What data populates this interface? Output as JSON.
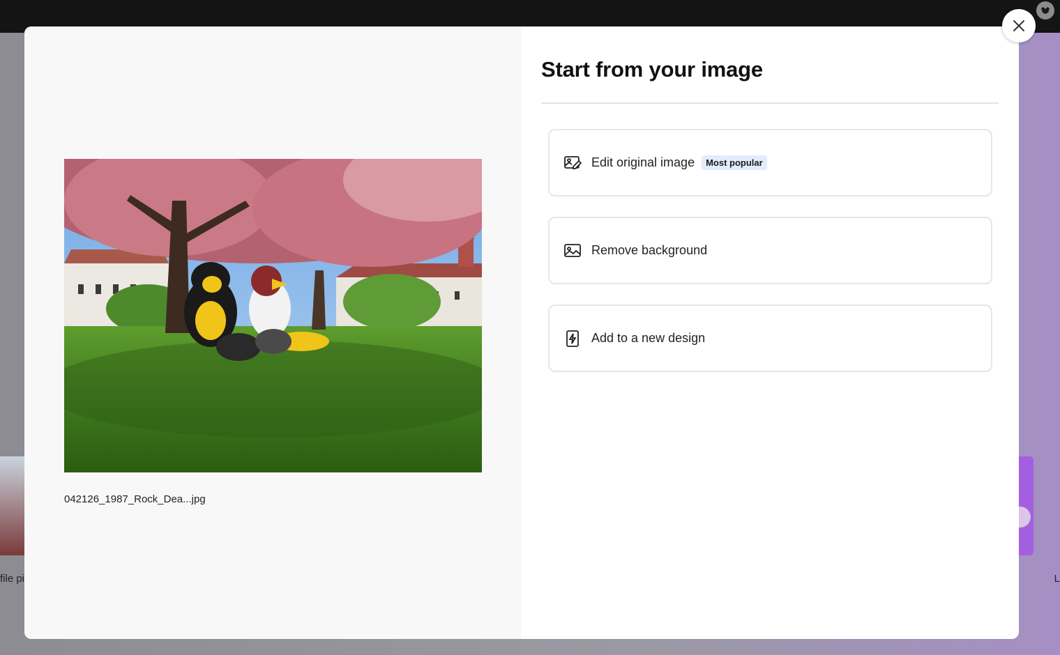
{
  "background": {
    "left_card_label": "file pi",
    "right_card_label": "L"
  },
  "modal": {
    "title": "Start from your image",
    "preview": {
      "file_name": "042126_1987_Rock_Dea...jpg"
    },
    "options": [
      {
        "label": "Edit original image",
        "icon": "edit-image-icon",
        "badge": "Most popular"
      },
      {
        "label": "Remove background",
        "icon": "image-icon"
      },
      {
        "label": "Add to a new design",
        "icon": "design-spark-icon"
      }
    ],
    "close_icon": "close-icon"
  }
}
